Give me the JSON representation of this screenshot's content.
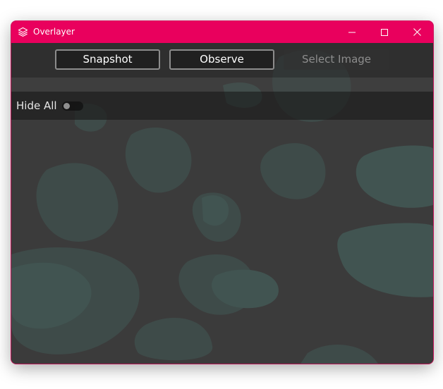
{
  "window": {
    "title": "Overlayer",
    "accent_color": "#e9005d",
    "icon": "layers-icon",
    "controls": {
      "minimize_icon": "minimize-icon",
      "maximize_icon": "maximize-icon",
      "close_icon": "close-icon"
    }
  },
  "toolbar": {
    "snapshot_label": "Snapshot",
    "observe_label": "Observe",
    "select_image_label": "Select Image",
    "select_image_enabled": false
  },
  "options": {
    "hide_all_label": "Hide All",
    "hide_all_on": false
  },
  "background": {
    "pattern": "camouflage",
    "base_color": "#3b3b3b",
    "blob_color": "#3e4e4c"
  }
}
